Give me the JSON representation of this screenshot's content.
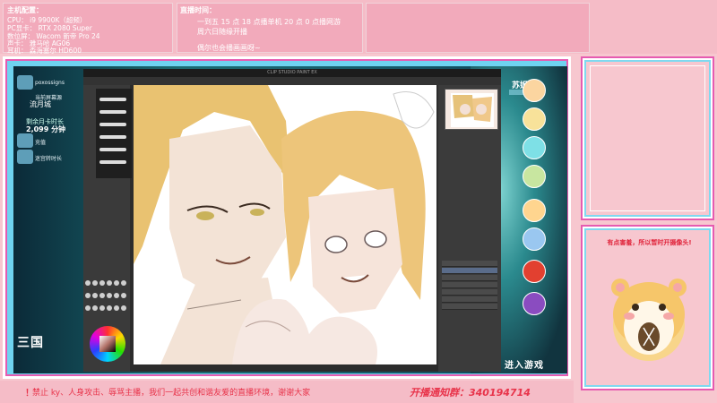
{
  "setup": {
    "title": "主机配置：",
    "lines": [
      "CPU：  i9 9900K（超频）",
      "PC显卡： RTX 2080 Super",
      "数位屏： Wacom 新帝 Pro 24",
      "声卡： 雅马哈 AG06",
      "耳机： 森海塞尔 HD600"
    ]
  },
  "schedule": {
    "title": "直播时间：",
    "lines": [
      "一到五 15 点 18 点播单机 20 点 0 点播网游",
      "周六日随缘开播",
      "偶尔也会播画画呀~"
    ]
  },
  "desktop": {
    "icon_labels": [
      "poxossigns",
      "当前屏幕源",
      "流月城"
    ],
    "status_text": "剩余月卡时长",
    "minutes": "2,099 分钟",
    "items": [
      "充值",
      "迷宫转时长"
    ],
    "bottom_label": "三国"
  },
  "csp": {
    "window_title": "CLIP STUDIO PAINT EX"
  },
  "game": {
    "title": "苏姐已",
    "enter_button": "进入游戏"
  },
  "sidebar_message": "有点害羞，所以暂时开摄像头!",
  "ticker": {
    "bang": "！",
    "rules": "禁止 ky、人身攻击、辱骂主播，我们一起共创和谐友爱的直播环境，谢谢大家",
    "fan_group": "开播通知群：340194714"
  },
  "colors": {
    "frame_pink": "#e65bb1",
    "frame_cyan": "#6fd3f0",
    "ticker_red": "#e8334a",
    "bg_pink": "#f7c7cf"
  }
}
